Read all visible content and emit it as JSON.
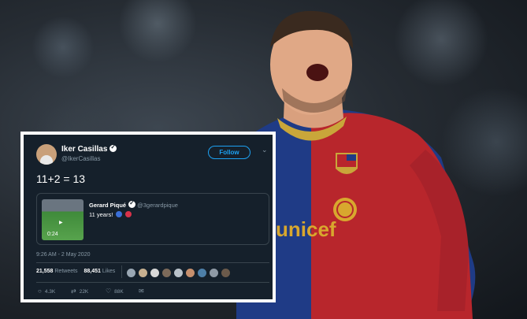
{
  "tweet": {
    "author_name": "Iker Casillas",
    "author_handle": "@IkerCasillas",
    "follow_label": "Follow",
    "text": "11+2 = 13",
    "quoted": {
      "author_name": "Gerard Piqué",
      "author_handle": "@3gerardpique",
      "text": "11 years!",
      "video_duration": "0:24"
    },
    "timestamp": "9:26 AM - 2 May 2020",
    "retweets_count": "21,558",
    "retweets_label": "Retweets",
    "likes_count": "88,451",
    "likes_label": "Likes",
    "actions": {
      "replies": "4.3K",
      "retweets": "22K",
      "likes": "88K"
    }
  },
  "background": {
    "jersey_sponsor": "unicef"
  },
  "colors": {
    "tweet_bg": "#15202b",
    "accent": "#1da1f2",
    "muted": "#8899a6",
    "barca_blue": "#1f3b86",
    "barca_red": "#b8262c"
  }
}
